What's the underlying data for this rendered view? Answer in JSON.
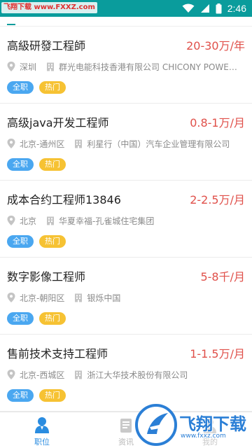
{
  "status_bar": {
    "time": "2:46",
    "background": "#0a9c9c",
    "watermark": "飞翔下载 www.FXXZ.com",
    "icons": [
      "wifi-icon",
      "signal-icon",
      "battery-icon"
    ]
  },
  "jobs": [
    {
      "title": "高級研發工程師",
      "salary": "20-30万/年",
      "location": "深圳",
      "company": "群光电能科技香港有限公司 CHICONY POWE…",
      "tags": [
        "全职",
        "热门"
      ]
    },
    {
      "title": "高级java开发工程师",
      "salary": "0.8-1万/月",
      "location": "北京-通州区",
      "company": "利星行（中国）汽车企业管理有限公司",
      "tags": [
        "全职",
        "热门"
      ]
    },
    {
      "title": "成本合约工程师13846",
      "salary": "2-2.5万/月",
      "location": "北京",
      "company": "华夏幸福-孔雀城住宅集团",
      "tags": [
        "全职",
        "热门"
      ]
    },
    {
      "title": "数字影像工程师",
      "salary": "5-8千/月",
      "location": "北京-朝阳区",
      "company": "银烁中国",
      "tags": [
        "全职",
        "热门"
      ]
    },
    {
      "title": "售前技术支持工程师",
      "salary": "1-1.5万/月",
      "location": "北京-西城区",
      "company": "浙江大华技术股份有限公司",
      "tags": [
        "全职",
        "热门"
      ]
    }
  ],
  "bottom_nav": {
    "items": [
      {
        "label": "职位",
        "icon": "person-icon",
        "active": true
      },
      {
        "label": "资讯",
        "icon": "document-icon",
        "active": false
      },
      {
        "label": "我的",
        "icon": "user-icon",
        "active": false
      }
    ]
  },
  "watermark": {
    "text": "飞翔下载",
    "url": "www.fxxz.com"
  },
  "colors": {
    "accent": "#0a9c9c",
    "salary": "#e0504a",
    "tag_fulltime": "#4aa7f0",
    "tag_hot": "#f6c233",
    "nav_active": "#2a8ce0"
  }
}
